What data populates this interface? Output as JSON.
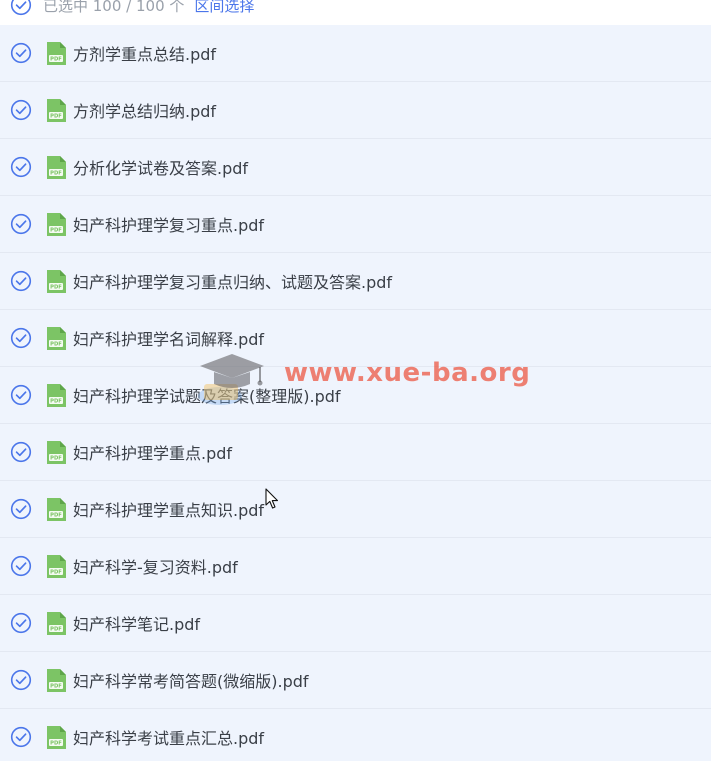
{
  "header": {
    "selected_text": "已选中 100 / 100 个",
    "range_select": "区间选择"
  },
  "colors": {
    "accent": "#4b76ea",
    "row_background": "#eff4fd",
    "pdf_icon": "#7cc465"
  },
  "files": [
    {
      "name": "方剂学重点总结.pdf",
      "checked": true,
      "icon": "pdf-file-icon"
    },
    {
      "name": "方剂学总结归纳.pdf",
      "checked": true,
      "icon": "pdf-file-icon"
    },
    {
      "name": "分析化学试卷及答案.pdf",
      "checked": true,
      "icon": "pdf-file-icon"
    },
    {
      "name": "妇产科护理学复习重点.pdf",
      "checked": true,
      "icon": "pdf-file-icon"
    },
    {
      "name": "妇产科护理学复习重点归纳、试题及答案.pdf",
      "checked": true,
      "icon": "pdf-file-icon"
    },
    {
      "name": "妇产科护理学名词解释.pdf",
      "checked": true,
      "icon": "pdf-file-icon"
    },
    {
      "name": "妇产科护理学试题及答案(整理版).pdf",
      "checked": true,
      "icon": "pdf-file-icon"
    },
    {
      "name": "妇产科护理学重点.pdf",
      "checked": true,
      "icon": "pdf-file-icon"
    },
    {
      "name": "妇产科护理学重点知识.pdf",
      "checked": true,
      "icon": "pdf-file-icon"
    },
    {
      "name": "妇产科学-复习资料.pdf",
      "checked": true,
      "icon": "pdf-file-icon"
    },
    {
      "name": "妇产科学笔记.pdf",
      "checked": true,
      "icon": "pdf-file-icon"
    },
    {
      "name": "妇产科学常考简答题(微缩版).pdf",
      "checked": true,
      "icon": "pdf-file-icon"
    },
    {
      "name": "妇产科学考试重点汇总.pdf",
      "checked": true,
      "icon": "pdf-file-icon"
    }
  ],
  "watermark": {
    "text": "www.xue-ba.org"
  }
}
